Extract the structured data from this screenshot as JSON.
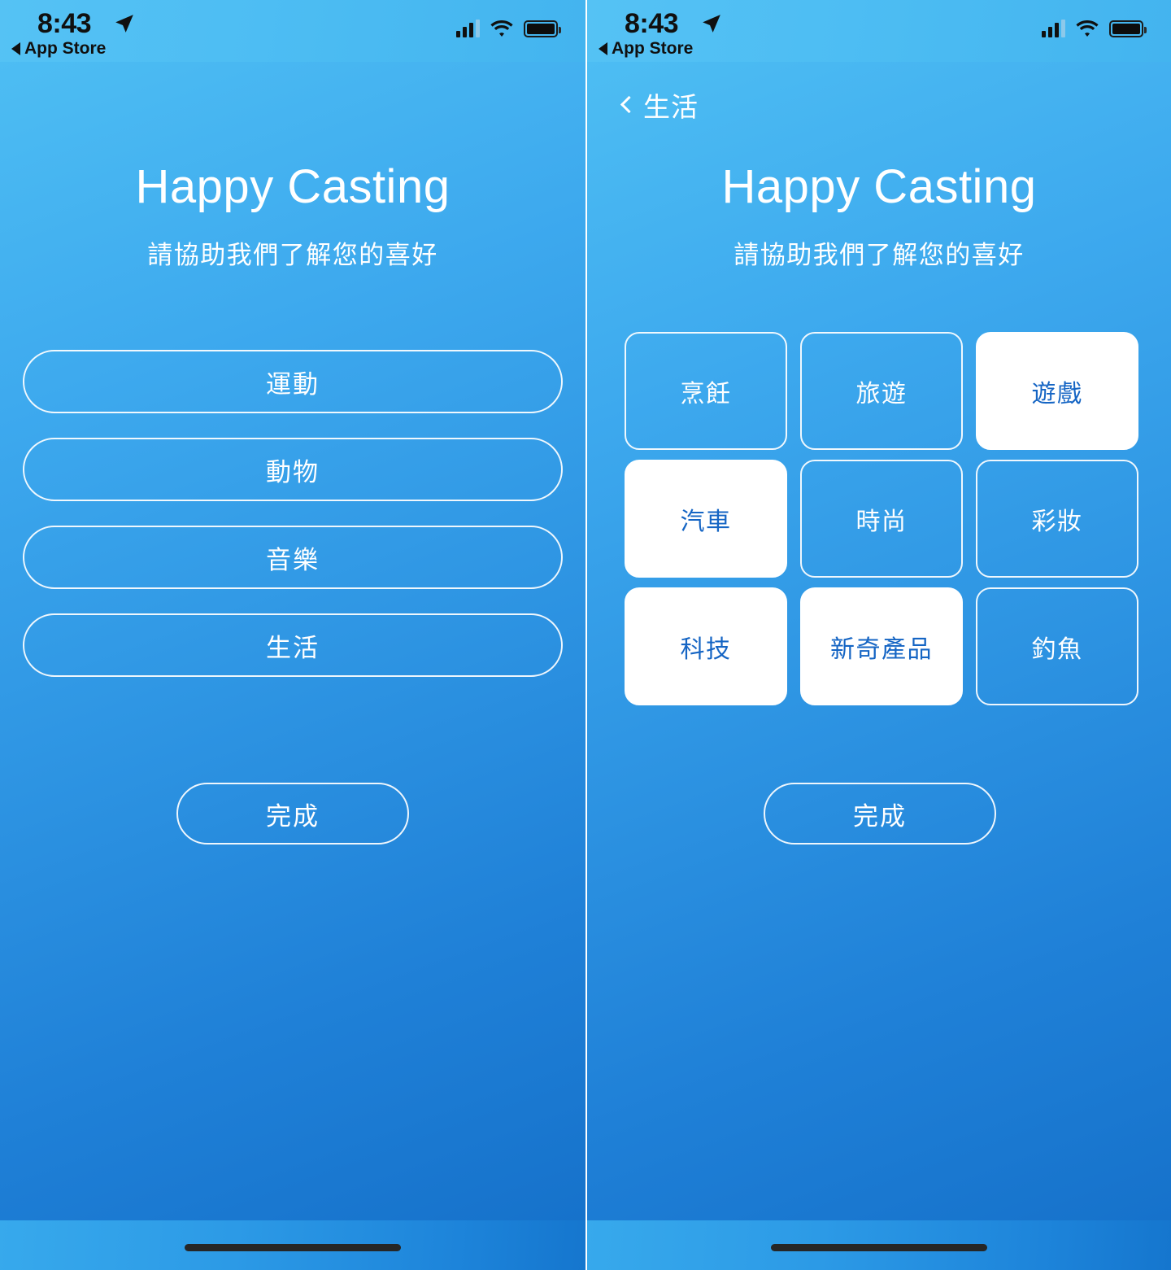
{
  "status_bar": {
    "time": "8:43",
    "back_app_label": "App Store",
    "location_icon": "location-arrow-icon",
    "signal_icon": "cellular-signal-icon",
    "signal_bars_filled": 3,
    "signal_bars_total": 4,
    "wifi_icon": "wifi-icon",
    "battery_icon": "battery-full-icon",
    "text_color": "#101010"
  },
  "app": {
    "title": "Happy Casting",
    "subtitle": "請協助我們了解您的喜好",
    "accent_selected_text": "#1565c4",
    "tile_selected_bg": "#ffffff",
    "background_top": "#4dbdf3",
    "background_bottom": "#1672cb"
  },
  "left_screen": {
    "categories": [
      {
        "label": "運動"
      },
      {
        "label": "動物"
      },
      {
        "label": "音樂"
      },
      {
        "label": "生活"
      }
    ],
    "done_label": "完成"
  },
  "right_screen": {
    "nav": {
      "back_label": "生活",
      "back_icon": "chevron-left-icon"
    },
    "tiles": [
      {
        "label": "烹飪",
        "selected": false
      },
      {
        "label": "旅遊",
        "selected": false
      },
      {
        "label": "遊戲",
        "selected": true
      },
      {
        "label": "汽車",
        "selected": true
      },
      {
        "label": "時尚",
        "selected": false
      },
      {
        "label": "彩妝",
        "selected": false
      },
      {
        "label": "科技",
        "selected": true
      },
      {
        "label": "新奇產品",
        "selected": true
      },
      {
        "label": "釣魚",
        "selected": false
      }
    ],
    "done_label": "完成"
  }
}
